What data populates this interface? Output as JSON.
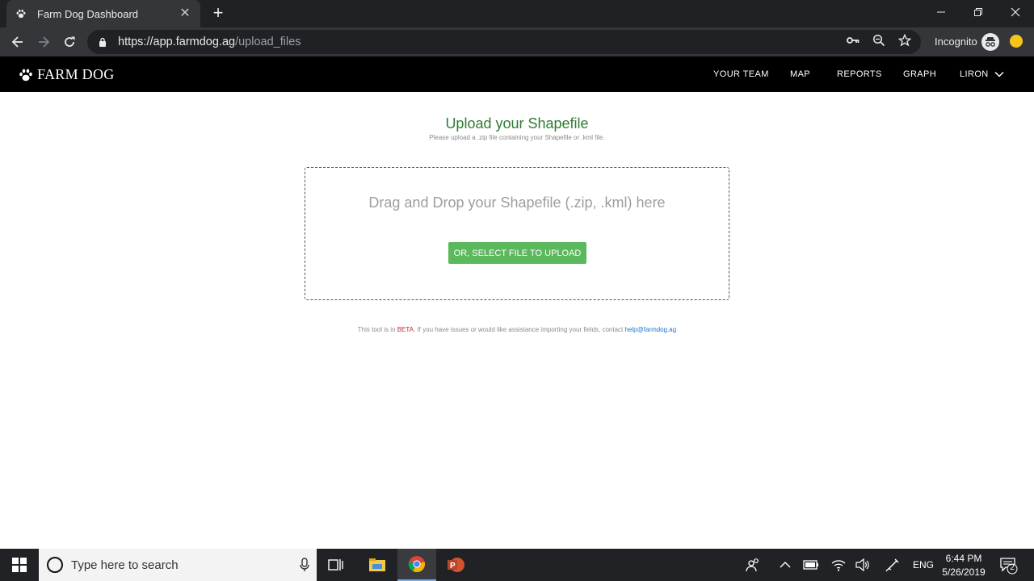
{
  "browser": {
    "tab_title": "Farm Dog Dashboard",
    "url_host": "https://app.farmdog.ag",
    "url_path": "/upload_files",
    "incognito_label": "Incognito"
  },
  "app": {
    "brand": "FARM DOG",
    "nav": [
      "YOUR TEAM",
      "MAP",
      "REPORTS",
      "GRAPH",
      "LIRON"
    ]
  },
  "upload": {
    "title": "Upload your Shapefile",
    "subtitle": "Please upload a .zip file containing your Shapefile or .kml file.",
    "drop_text": "Drag and Drop your Shapefile (.zip, .kml) here",
    "button_label": "OR, SELECT FILE TO UPLOAD",
    "beta_prefix": "This tool is in ",
    "beta_word": "BETA",
    "beta_suffix": ". If you have issues or would like assistance importing your fields, contact ",
    "help_email": "help@farmdog.ag"
  },
  "taskbar": {
    "search_placeholder": "Type here to search",
    "language": "ENG",
    "time": "6:44 PM",
    "date": "5/26/2019",
    "notification_count": "2"
  },
  "colors": {
    "title_green": "#2e7d32",
    "button_green": "#5cb85c",
    "beta_red": "#c62828",
    "link_blue": "#1976d2"
  }
}
